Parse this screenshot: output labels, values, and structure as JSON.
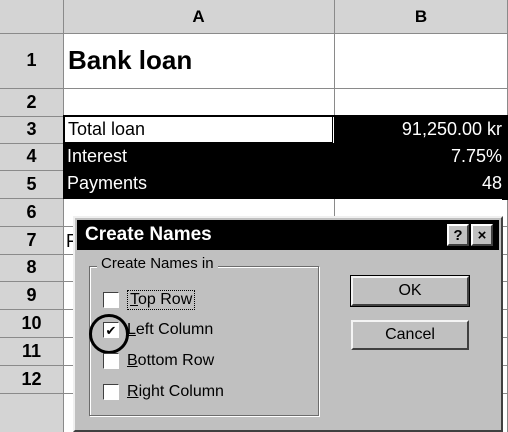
{
  "columns": [
    "A",
    "B"
  ],
  "rows": [
    "1",
    "2",
    "3",
    "4",
    "5",
    "6",
    "7",
    "8",
    "9",
    "10",
    "11",
    "12"
  ],
  "cells": {
    "a1": "Bank loan",
    "a3": "Total loan",
    "b3": "91,250.00 kr",
    "a4": "Interest",
    "b4": "7.75%",
    "a5": "Payments",
    "b5": "48",
    "a7_partial": "F"
  },
  "dialog": {
    "title": "Create Names",
    "help_label": "?",
    "close_label": "×",
    "group_label": "Create Names in",
    "options": [
      {
        "mnemonic": "T",
        "rest": "op Row",
        "checked": false
      },
      {
        "mnemonic": "L",
        "rest": "eft Column",
        "checked": true
      },
      {
        "mnemonic": "B",
        "rest": "ottom Row",
        "checked": false
      },
      {
        "mnemonic": "R",
        "rest": "ight Column",
        "checked": false
      }
    ],
    "ok_label": "OK",
    "cancel_label": "Cancel",
    "check_mark": "✔"
  }
}
